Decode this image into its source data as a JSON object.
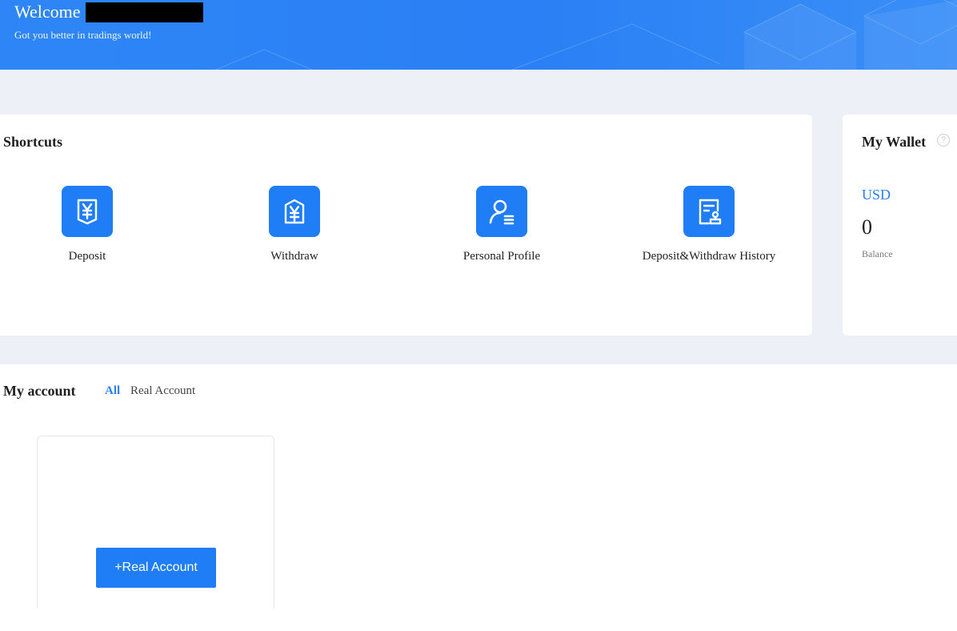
{
  "header": {
    "welcome": "Welcome",
    "tagline": "Got you better in tradings world!"
  },
  "shortcuts": {
    "title": "Shortcuts",
    "items": [
      {
        "label": "Deposit",
        "icon": "deposit-yen-icon"
      },
      {
        "label": "Withdraw",
        "icon": "withdraw-yen-icon"
      },
      {
        "label": "Personal Profile",
        "icon": "profile-user-icon"
      },
      {
        "label": "Deposit&Withdraw History",
        "icon": "history-document-icon"
      }
    ]
  },
  "wallet": {
    "title": "My Wallet",
    "help": "?",
    "currency": "USD",
    "balance": "0",
    "balance_label": "Balance"
  },
  "account": {
    "title": "My account",
    "tabs": [
      {
        "label": "All",
        "active": true
      },
      {
        "label": "Real Account",
        "active": false
      }
    ],
    "add_button": "+Real Account"
  },
  "colors": {
    "primary": "#1f7ef6",
    "banner": "#2e86f6",
    "background": "#edf0f6",
    "link": "#2c7ef3"
  }
}
